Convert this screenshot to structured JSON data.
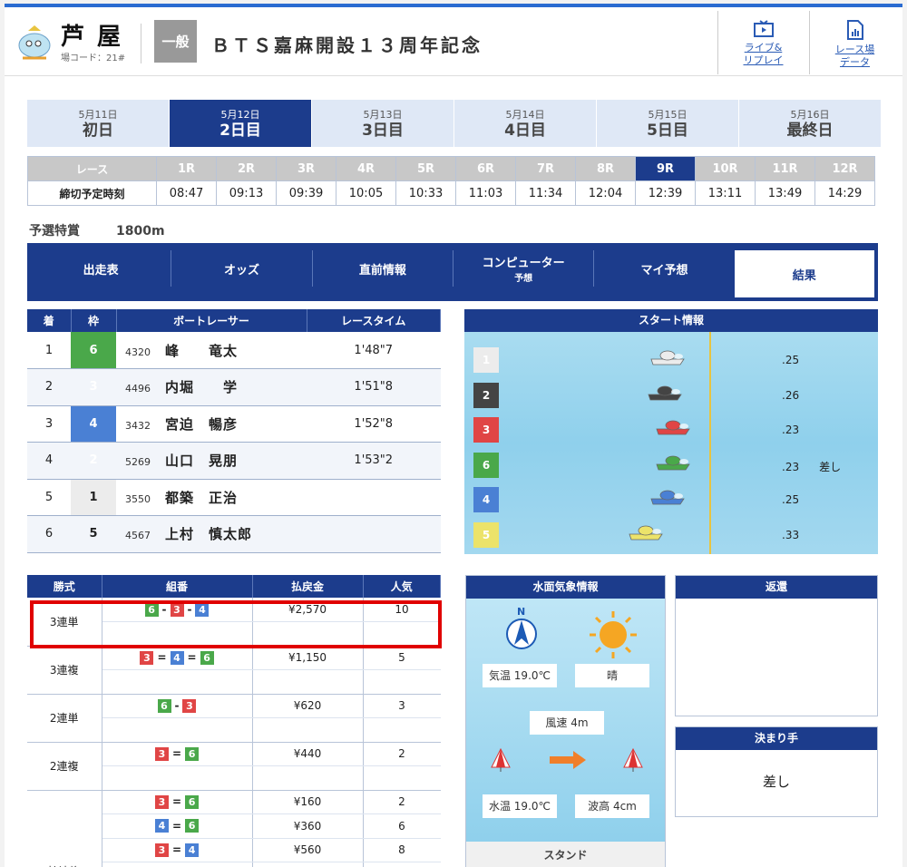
{
  "header": {
    "venue": "芦屋",
    "venue_code": "場コード：21#",
    "grade": "一般",
    "title": "ＢＴＳ嘉麻開設１３周年記念",
    "live": "ライブ&\nリプレイ",
    "data": "レース場\nデータ"
  },
  "days": [
    {
      "date": "5月11日",
      "name": "初日"
    },
    {
      "date": "5月12日",
      "name": "2日目"
    },
    {
      "date": "5月13日",
      "name": "3日目"
    },
    {
      "date": "5月14日",
      "name": "4日目"
    },
    {
      "date": "5月15日",
      "name": "5日目"
    },
    {
      "date": "5月16日",
      "name": "最終日"
    }
  ],
  "race_label": "レース",
  "deadline_label": "締切予定時刻",
  "races": [
    "1R",
    "2R",
    "3R",
    "4R",
    "5R",
    "6R",
    "7R",
    "8R",
    "9R",
    "10R",
    "11R",
    "12R"
  ],
  "times": [
    "08:47",
    "09:13",
    "09:39",
    "10:05",
    "10:33",
    "11:03",
    "11:34",
    "12:04",
    "12:39",
    "13:11",
    "13:49",
    "14:29"
  ],
  "race_info": {
    "type": "予選特賞",
    "distance": "1800m"
  },
  "tabs": [
    {
      "label": "出走表",
      "sub": ""
    },
    {
      "label": "オッズ",
      "sub": ""
    },
    {
      "label": "直前情報",
      "sub": ""
    },
    {
      "label": "コンピューター",
      "sub": "予想"
    },
    {
      "label": "マイ予想",
      "sub": ""
    },
    {
      "label": "結果",
      "sub": ""
    }
  ],
  "result": {
    "headers": [
      "着",
      "枠",
      "ボートレーサー",
      "レースタイム"
    ],
    "rows": [
      {
        "pos": "1",
        "frame": "6",
        "no": "4320",
        "name": "峰　　竜太",
        "time": "1'48\"7"
      },
      {
        "pos": "2",
        "frame": "3",
        "no": "4496",
        "name": "内堀　　学",
        "time": "1'51\"8"
      },
      {
        "pos": "3",
        "frame": "4",
        "no": "3432",
        "name": "宮迫　暢彦",
        "time": "1'52\"8"
      },
      {
        "pos": "4",
        "frame": "2",
        "no": "5269",
        "name": "山口　晃朋",
        "time": "1'53\"2"
      },
      {
        "pos": "5",
        "frame": "1",
        "no": "3550",
        "name": "都築　正治",
        "time": ""
      },
      {
        "pos": "6",
        "frame": "5",
        "no": "4567",
        "name": "上村　慎太郎",
        "time": ""
      }
    ]
  },
  "start": {
    "title": "スタート情報",
    "rows": [
      {
        "boat": "1",
        "st": ".25",
        "note": ""
      },
      {
        "boat": "2",
        "st": ".26",
        "note": ""
      },
      {
        "boat": "3",
        "st": ".23",
        "note": ""
      },
      {
        "boat": "6",
        "st": ".23",
        "note": "差し"
      },
      {
        "boat": "4",
        "st": ".25",
        "note": ""
      },
      {
        "boat": "5",
        "st": ".33",
        "note": ""
      }
    ]
  },
  "payout": {
    "headers": [
      "勝式",
      "組番",
      "払戻金",
      "人気"
    ],
    "groups": [
      {
        "kind": "3連単",
        "items": [
          {
            "combo": [
              "6",
              "-",
              "3",
              "-",
              "4"
            ],
            "amount": "¥2,570",
            "pop": "10"
          }
        ]
      },
      {
        "kind": "3連複",
        "items": [
          {
            "combo": [
              "3",
              "=",
              "4",
              "=",
              "6"
            ],
            "amount": "¥1,150",
            "pop": "5"
          }
        ]
      },
      {
        "kind": "2連単",
        "items": [
          {
            "combo": [
              "6",
              "-",
              "3"
            ],
            "amount": "¥620",
            "pop": "3"
          }
        ]
      },
      {
        "kind": "2連複",
        "items": [
          {
            "combo": [
              "3",
              "=",
              "6"
            ],
            "amount": "¥440",
            "pop": "2"
          }
        ]
      },
      {
        "kind": "拡連複",
        "items": [
          {
            "combo": [
              "3",
              "=",
              "6"
            ],
            "amount": "¥160",
            "pop": "2"
          },
          {
            "combo": [
              "4",
              "=",
              "6"
            ],
            "amount": "¥360",
            "pop": "6"
          },
          {
            "combo": [
              "3",
              "=",
              "4"
            ],
            "amount": "¥560",
            "pop": "8"
          }
        ]
      }
    ]
  },
  "weather": {
    "title": "水面気象情報",
    "north": "N",
    "temp": "気温 19.0℃",
    "condition": "晴",
    "wind": "風速 4m",
    "water_temp": "水温 19.0℃",
    "wave": "波高 4cm",
    "stand": "スタンド"
  },
  "refund": {
    "title": "返還",
    "value": ""
  },
  "kimarite": {
    "title": "決まり手",
    "value": "差し"
  },
  "colors": {
    "navy": "#1c3c8c",
    "highlight": "#e00000",
    "c1": "#ececec",
    "c2": "#444444",
    "c3": "#e04545",
    "c4": "#4a80d4",
    "c5": "#ece36a",
    "c6": "#4aa84a"
  }
}
